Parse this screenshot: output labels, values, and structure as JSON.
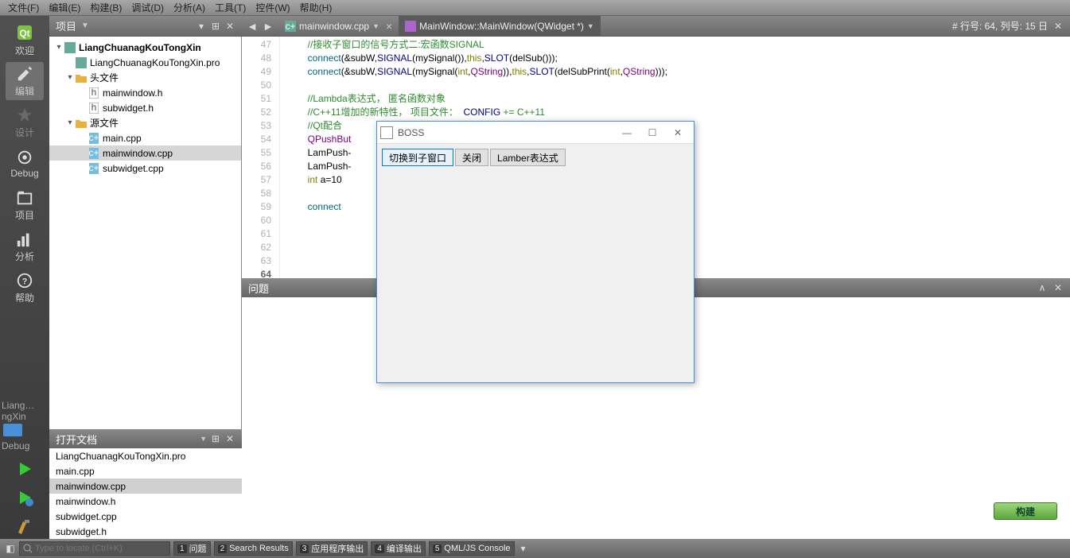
{
  "menu": {
    "file": "文件(F)",
    "edit": "编辑(E)",
    "build": "构建(B)",
    "debug": "调试(D)",
    "analyze": "分析(A)",
    "tools": "工具(T)",
    "widgets": "控件(W)",
    "help": "帮助(H)"
  },
  "sidebar": {
    "welcome": "欢迎",
    "edit": "编辑",
    "design": "设计",
    "debug": "Debug",
    "project": "项目",
    "analyze": "分析",
    "help": "帮助",
    "kit": "Liang…ngXin",
    "kit_mode": "Debug"
  },
  "project_panel": {
    "title": "项目",
    "tree": {
      "root": "LiangChuanagKouTongXin",
      "pro": "LiangChuanagKouTongXin.pro",
      "headers_label": "头文件",
      "headers": [
        "mainwindow.h",
        "subwidget.h"
      ],
      "sources_label": "源文件",
      "sources": [
        "main.cpp",
        "mainwindow.cpp",
        "subwidget.cpp"
      ]
    }
  },
  "open_docs": {
    "title": "打开文档",
    "items": [
      "LiangChuanagKouTongXin.pro",
      "main.cpp",
      "mainwindow.cpp",
      "mainwindow.h",
      "subwidget.cpp",
      "subwidget.h"
    ],
    "selected": "mainwindow.cpp"
  },
  "editor": {
    "tab_file": "mainwindow.cpp",
    "crumb": "MainWindow::MainWindow(QWidget *)",
    "status": "# 行号: 64, 列号: 15 日",
    "first_line": 47,
    "current_line": 64,
    "lines": [
      {
        "t": "comment",
        "text": "        //接收子窗口的信号方式二:宏函数SIGNAL"
      },
      {
        "t": "code",
        "text": "        connect(&subW,SIGNAL(mySignal()),this,SLOT(delSub()));"
      },
      {
        "t": "code",
        "text": "        connect(&subW,SIGNAL(mySignal(int,QString)),this,SLOT(delSubPrint(int,QString)));"
      },
      {
        "t": "blank",
        "text": ""
      },
      {
        "t": "comment",
        "text": "        //Lambda表达式， 匿名函数对象"
      },
      {
        "t": "comment2",
        "text": "        //C++11增加的新特性， 项目文件：  CONFIG += C++11"
      },
      {
        "t": "comment",
        "text": "        //Qt配合"
      },
      {
        "t": "code",
        "text": "        QPushBut"
      },
      {
        "t": "code",
        "text": "        LamPush-"
      },
      {
        "t": "code",
        "text": "        LamPush-"
      },
      {
        "t": "code",
        "text": "        int a=10"
      },
      {
        "t": "blank",
        "text": ""
      },
      {
        "t": "code",
        "text": "        connect"
      },
      {
        "t": "blank",
        "text": ""
      },
      {
        "t": "blank",
        "text": ""
      },
      {
        "t": "blank",
        "text": ""
      },
      {
        "t": "blank",
        "text": ""
      },
      {
        "t": "blank",
        "text": ""
      },
      {
        "t": "blank",
        "text": ""
      },
      {
        "t": "blank",
        "text": ""
      },
      {
        "t": "code",
        "text": "    }"
      },
      {
        "t": "blank",
        "text": ""
      }
    ]
  },
  "problems": {
    "title": "问题"
  },
  "bottom": {
    "locator_placeholder": "Type to locate (Ctrl+K)",
    "tabs": [
      {
        "n": "1",
        "l": "问题"
      },
      {
        "n": "2",
        "l": "Search Results"
      },
      {
        "n": "3",
        "l": "应用程序输出"
      },
      {
        "n": "4",
        "l": "编译输出"
      },
      {
        "n": "5",
        "l": "QML/JS Console"
      }
    ]
  },
  "build_button": "构建",
  "popup": {
    "title": "BOSS",
    "buttons": [
      "切换到子窗口",
      "关闭",
      "Lamber表达式"
    ]
  }
}
